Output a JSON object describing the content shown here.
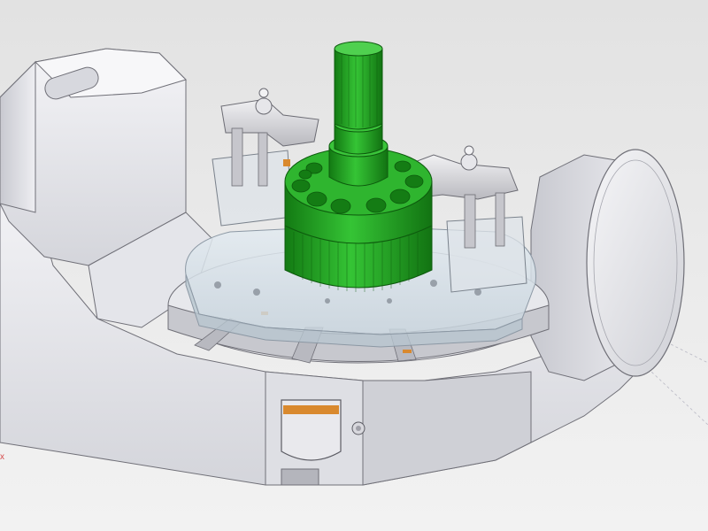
{
  "viewport": {
    "background": "#e6e6e6",
    "axis_label": "x"
  },
  "colors": {
    "fixture_body": "#ececf0",
    "fixture_shadow": "#c9cad0",
    "fixture_outline": "#707078",
    "workpiece_green": "#1fa51f",
    "workpiece_dark": "#127312",
    "workpiece_light": "#4fd04f",
    "glass": "#d9e4ec",
    "clamp": "#d0d0d4",
    "accent_orange": "#d9892e",
    "axis_red": "#d64a4a"
  },
  "scene": {
    "parts": [
      "trunnion-frame",
      "left-trunnion-support",
      "right-trunnion-disc",
      "rotary-table",
      "glass-fixture-plate",
      "left-clamp-assembly",
      "right-clamp-assembly",
      "green-workpiece-shaft",
      "green-workpiece-hub",
      "front-access-window"
    ]
  }
}
